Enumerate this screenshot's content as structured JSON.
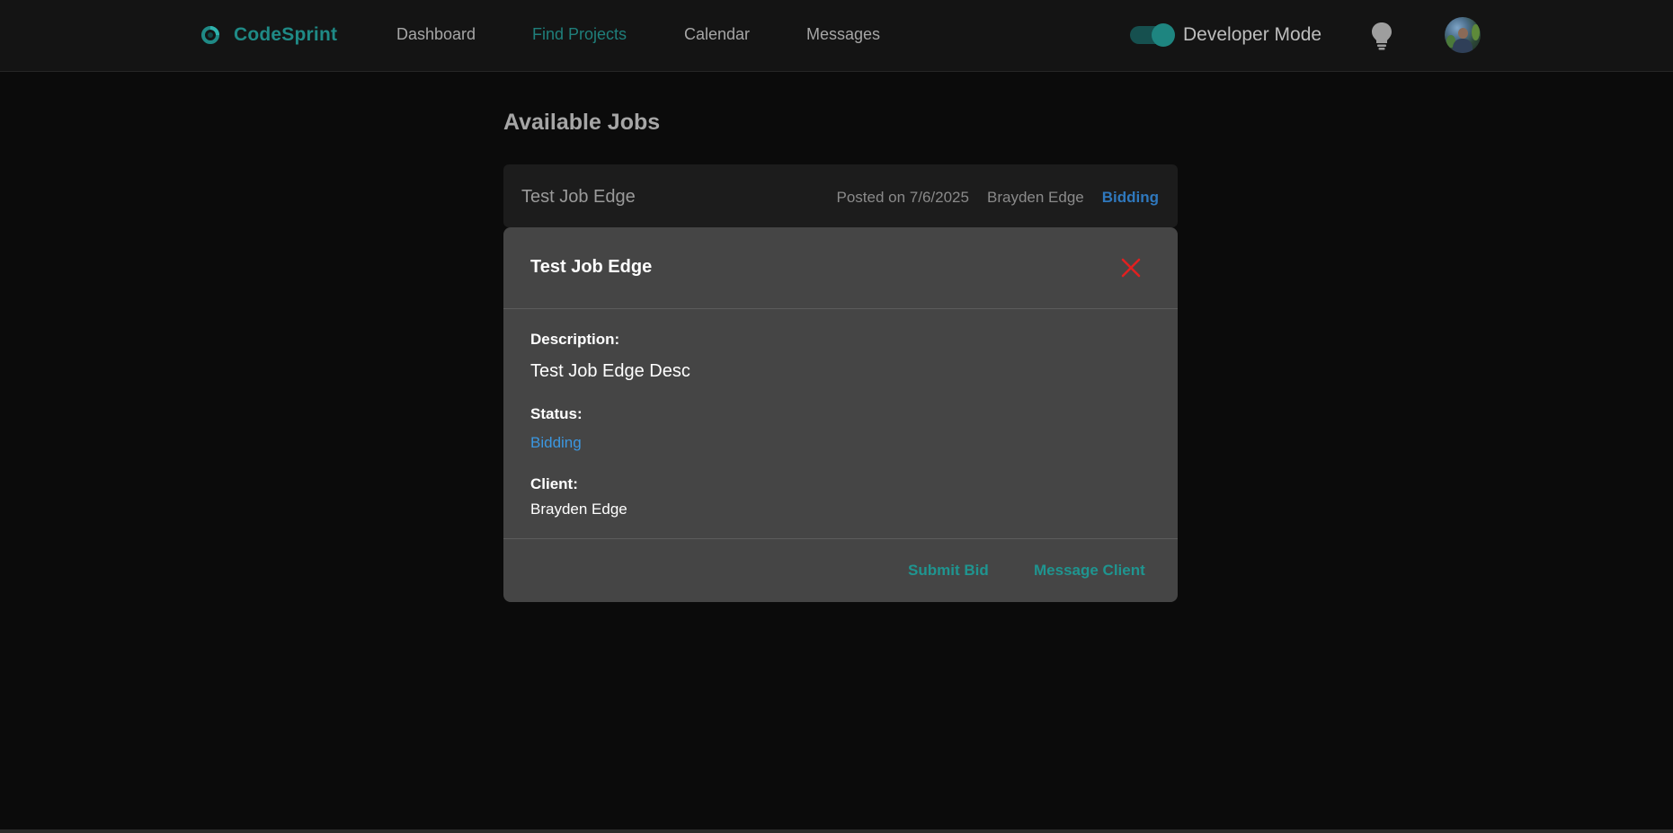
{
  "nav": {
    "brand": "CodeSprint",
    "links": [
      "Dashboard",
      "Find Projects",
      "Calendar",
      "Messages"
    ],
    "active_link": "Find Projects",
    "developer_mode_label": "Developer Mode",
    "developer_mode_on": true,
    "bulb_icon": "lightbulb-icon",
    "avatar_icon": "user-avatar"
  },
  "page": {
    "title": "Available Jobs"
  },
  "job": {
    "title": "Test Job Edge",
    "posted": "Posted on 7/6/2025",
    "client": "Brayden Edge",
    "status": "Bidding"
  },
  "modal": {
    "title": "Test Job Edge",
    "close_icon": "close-icon",
    "description_label": "Description:",
    "description_value": "Test Job Edge Desc",
    "status_label": "Status:",
    "status_value": "Bidding",
    "client_label": "Client:",
    "client_value": "Brayden Edge",
    "submit_bid_label": "Submit Bid",
    "message_client_label": "Message Client"
  },
  "colors": {
    "brand": "#1f8a86",
    "status": "#3b97e0",
    "close": "#e02020",
    "accent_button": "#1f9590"
  }
}
